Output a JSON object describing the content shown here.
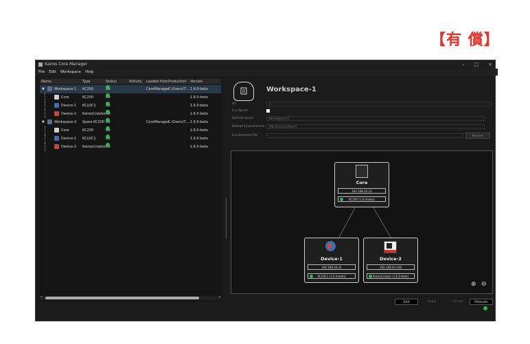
{
  "badge": "【有 償】",
  "window": {
    "title": "Kairos Core Manager",
    "controls": [
      "–",
      "□",
      "×"
    ]
  },
  "menu": [
    "File",
    "Edit",
    "Workspace",
    "Help"
  ],
  "tree": {
    "columns": [
      "Name",
      "Type",
      "Status",
      "Activity",
      "Loaded from",
      "Production",
      "Version"
    ],
    "rows": [
      {
        "name": "Workspace-1",
        "type": "KC200",
        "status": "Ok",
        "activity": "",
        "loaded_from": "CoreManager",
        "production": "C:/Users/7...",
        "version": "1.6.0-beta",
        "icon": "workspace-icon",
        "level": 0
      },
      {
        "name": "Core",
        "type": "KC200",
        "status": "Ok",
        "activity": "",
        "loaded_from": "",
        "production": "",
        "version": "1.6.0-beta",
        "icon": "server-icon",
        "level": 1
      },
      {
        "name": "Device-1",
        "type": "KCLOC1",
        "status": "Ok",
        "activity": "",
        "loaded_from": "",
        "production": "",
        "version": "1.6.0-beta",
        "icon": "device-icon",
        "level": 1
      },
      {
        "name": "Device-2",
        "type": "KairosCreator",
        "status": "Ok",
        "activity": "",
        "loaded_from": "",
        "production": "",
        "version": "1.6.0-beta",
        "icon": "creator-icon",
        "level": 1
      },
      {
        "name": "Workspace-2",
        "type": "Spare KC200",
        "status": "Ok",
        "activity": "",
        "loaded_from": "CoreManager",
        "production": "C:/Users/7...",
        "version": "1.6.0-beta",
        "icon": "workspace-icon",
        "level": 0
      },
      {
        "name": "Core",
        "type": "KC200",
        "status": "Ok",
        "activity": "",
        "loaded_from": "",
        "production": "",
        "version": "1.6.0-beta",
        "icon": "server-icon",
        "level": 1
      },
      {
        "name": "Device-1",
        "type": "KCLOC1",
        "status": "Ok",
        "activity": "",
        "loaded_from": "",
        "production": "",
        "version": "1.6.0-beta",
        "icon": "device-icon",
        "level": 1
      },
      {
        "name": "Device-2",
        "type": "KairosCreator",
        "status": "Ok",
        "activity": "",
        "loaded_from": "",
        "production": "",
        "version": "1.6.0-beta",
        "icon": "creator-icon",
        "level": 1
      }
    ]
  },
  "detail": {
    "title": "Workspace-1",
    "fields": [
      {
        "label": "ID:",
        "value": "1"
      },
      {
        "label": "Is a Spare:",
        "value": ""
      },
      {
        "label": "Default spare:",
        "value": "Workspace-2"
      },
      {
        "label": "Default Environment:",
        "value": "[No Environment]"
      },
      {
        "label": "Environment file:",
        "value": ""
      }
    ],
    "browse_label": "Browse"
  },
  "diagram": {
    "nodes": [
      {
        "name": "Core",
        "ip": "192.168.20.23",
        "status": "KC200 (1.6.0-beta)"
      },
      {
        "name": "Device-1",
        "ip": "192.168.30.41",
        "status": "KCLOC1 (1.6.0-beta)"
      },
      {
        "name": "Device-2",
        "ip": "192.168.20.148",
        "status": "KairosCreator (1.6.0-beta)"
      }
    ]
  },
  "buttons": {
    "edit": "Edit",
    "apply": "Apply",
    "cancel": "Cancel",
    "relocate": "Relocate"
  },
  "colors": {
    "ok": "#2db84a",
    "badge": "#e8322d",
    "selection": "#2b3a4a"
  }
}
